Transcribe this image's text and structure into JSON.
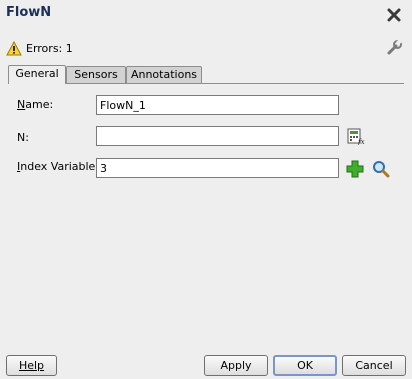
{
  "dialog": {
    "title": "FlowN"
  },
  "status": {
    "errors_text": "Errors: 1"
  },
  "tabs": [
    {
      "label": "General"
    },
    {
      "label": "Sensors"
    },
    {
      "label": "Annotations"
    }
  ],
  "form": {
    "name": {
      "label_first": "N",
      "label_rest": "ame:",
      "value": "FlowN_1"
    },
    "n": {
      "label": "N:",
      "value": ""
    },
    "index_variable": {
      "label_first": "I",
      "label_rest": "ndex Variable:",
      "value": "3"
    }
  },
  "buttons": {
    "help": "Help",
    "apply": "Apply",
    "ok": "OK",
    "cancel": "Cancel"
  },
  "colors": {
    "title": "#1c2f58",
    "tab_inactive": "#d2d2d2",
    "background": "#eeeeee"
  }
}
